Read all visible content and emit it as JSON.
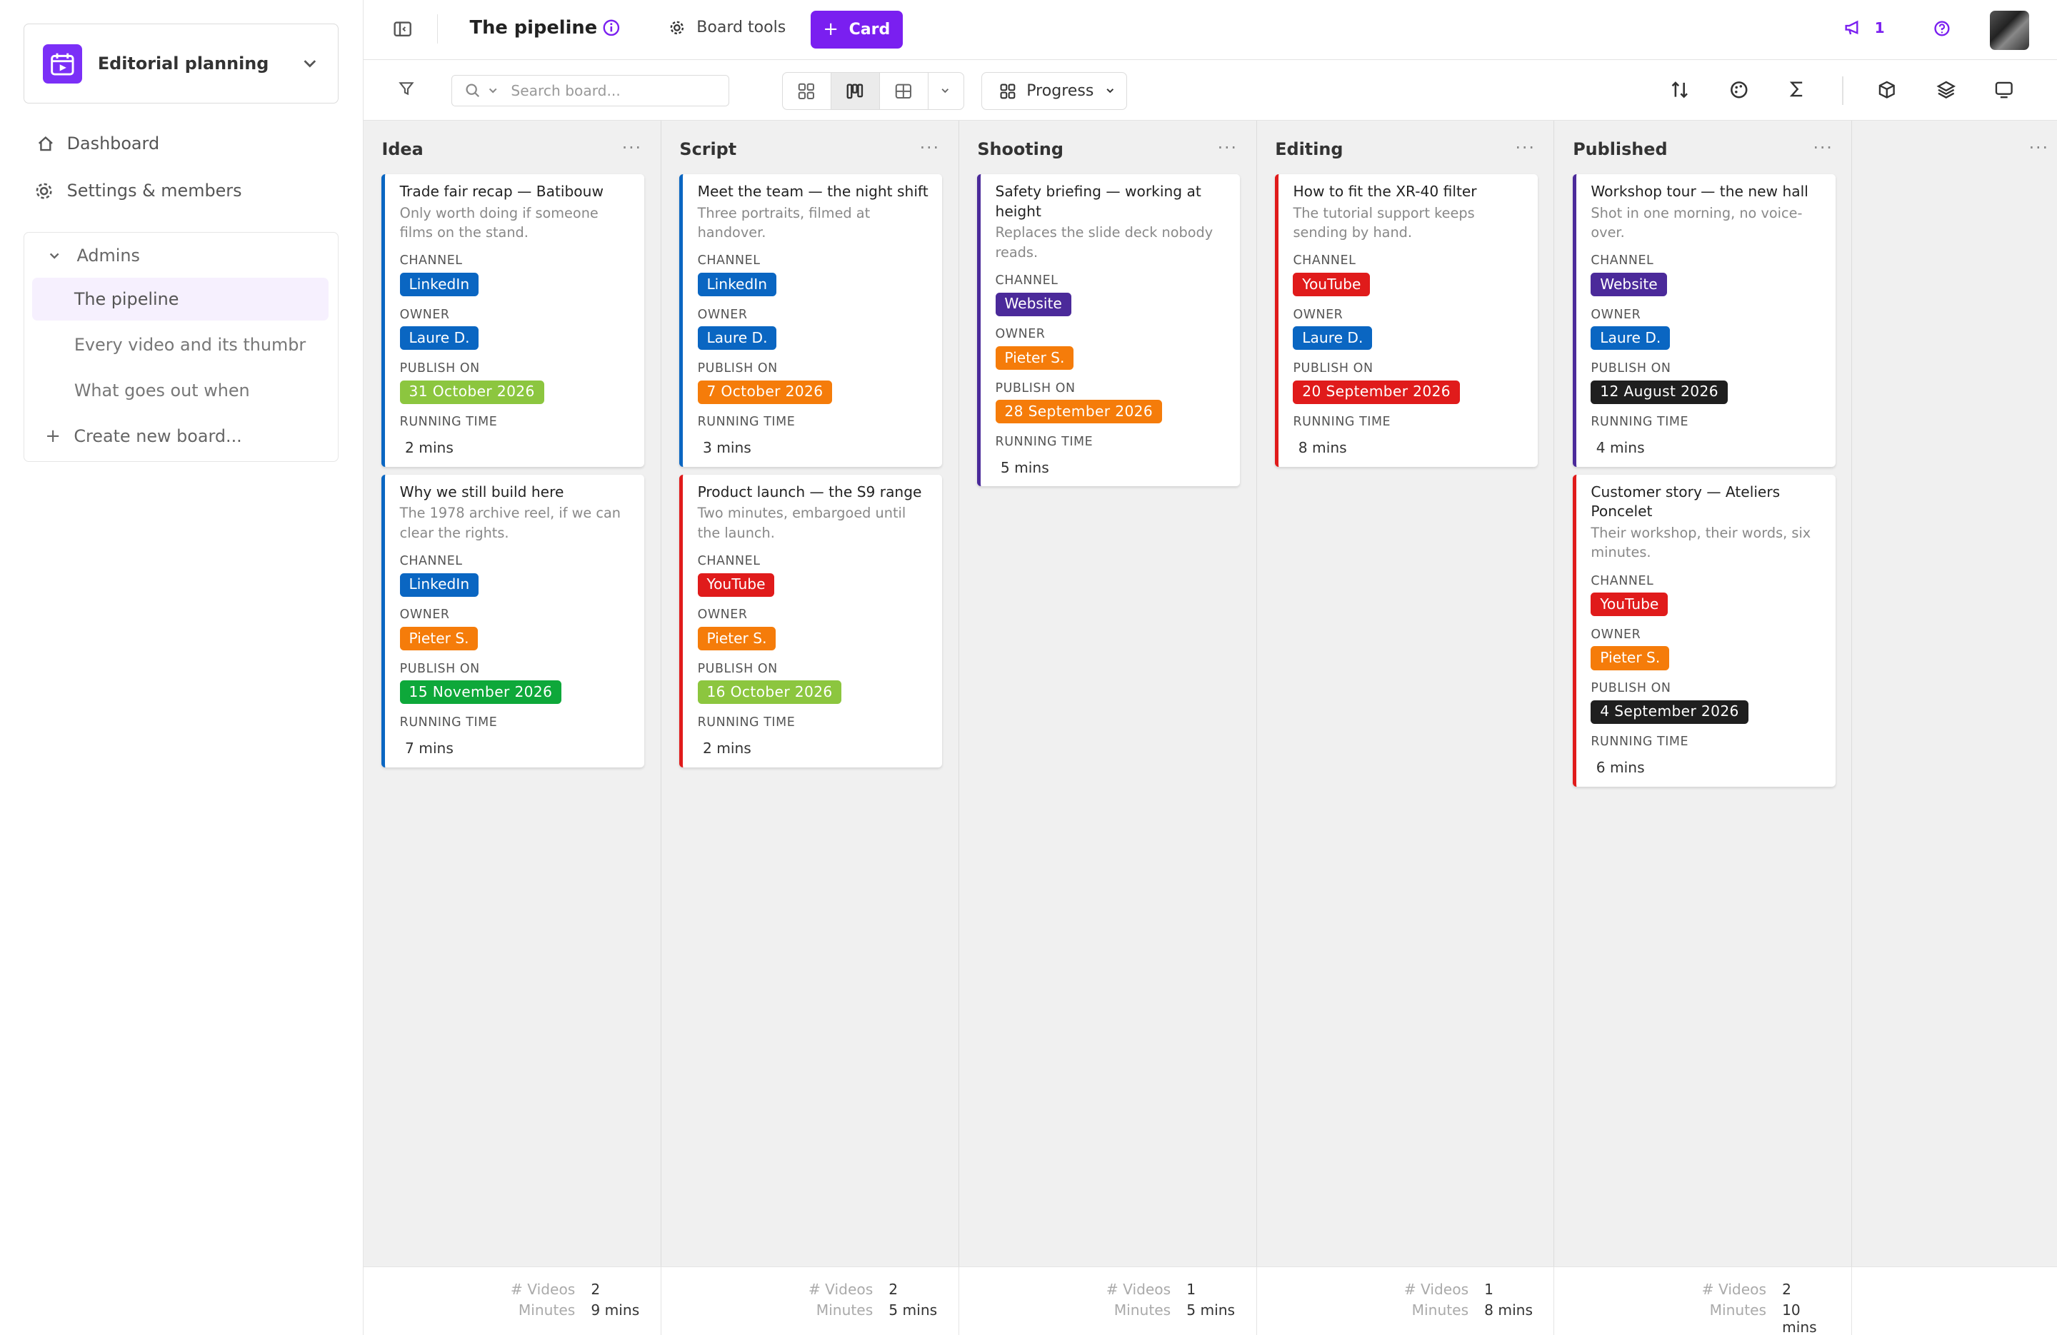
{
  "sidebar": {
    "workspace": "Editorial planning",
    "nav": [
      {
        "label": "Dashboard",
        "icon": "home-icon"
      },
      {
        "label": "Settings & members",
        "icon": "gear-icon"
      }
    ],
    "section_title": "Admins",
    "boards": [
      {
        "label": "The pipeline",
        "active": true
      },
      {
        "label": "Every video and its thumbr",
        "active": false
      },
      {
        "label": "What goes out when",
        "active": false
      }
    ],
    "create_label": "Create new board..."
  },
  "topbar": {
    "title": "The pipeline",
    "board_tools": "Board tools",
    "card_button": "Card",
    "notification_count": "1"
  },
  "toolbar": {
    "search_placeholder": "Search board...",
    "group_by": "Progress"
  },
  "labels": {
    "channel": "CHANNEL",
    "owner": "OWNER",
    "publish_on": "PUBLISH ON",
    "running_time": "RUNNING TIME",
    "footer_count": "# Videos",
    "footer_minutes": "Minutes"
  },
  "colors": {
    "accent": "#7a1ff0",
    "linkedin": "#0a66c2",
    "youtube": "#e01b1b",
    "website": "#4b2a9a",
    "laure": "#0a66c2",
    "pieter": "#f57c0a"
  },
  "columns": [
    {
      "title": "Idea",
      "count": "2",
      "minutes": "9 mins",
      "cards": [
        {
          "title": "Trade fair recap — Batibouw",
          "desc": "Only worth doing if someone films on the stand.",
          "channel": "LinkedIn",
          "owner": "Laure D.",
          "publish": "31 October 2026",
          "publish_color": "#8cc63f",
          "running": "2 mins"
        },
        {
          "title": "Why we still build here",
          "desc": "The 1978 archive reel, if we can clear the rights.",
          "channel": "LinkedIn",
          "owner": "Pieter S.",
          "publish": "15 November 2026",
          "publish_color": "#0ea83a",
          "running": "7 mins"
        }
      ]
    },
    {
      "title": "Script",
      "count": "2",
      "minutes": "5 mins",
      "cards": [
        {
          "title": "Meet the team — the night shift",
          "desc": "Three portraits, filmed at handover.",
          "channel": "LinkedIn",
          "owner": "Laure D.",
          "publish": "7 October 2026",
          "publish_color": "#f57c0a",
          "running": "3 mins"
        },
        {
          "title": "Product launch — the S9 range",
          "desc": "Two minutes, embargoed until the launch.",
          "channel": "YouTube",
          "owner": "Pieter S.",
          "publish": "16 October 2026",
          "publish_color": "#8cc63f",
          "running": "2 mins"
        }
      ]
    },
    {
      "title": "Shooting",
      "count": "1",
      "minutes": "5 mins",
      "cards": [
        {
          "title": "Safety briefing — working at height",
          "desc": "Replaces the slide deck nobody reads.",
          "channel": "Website",
          "owner": "Pieter S.",
          "publish": "28 September 2026",
          "publish_color": "#f57c0a",
          "running": "5 mins"
        }
      ]
    },
    {
      "title": "Editing",
      "count": "1",
      "minutes": "8 mins",
      "cards": [
        {
          "title": "How to fit the XR-40 filter",
          "desc": "The tutorial support keeps sending by hand.",
          "channel": "YouTube",
          "owner": "Laure D.",
          "publish": "20 September 2026",
          "publish_color": "#e01b1b",
          "running": "8 mins"
        }
      ]
    },
    {
      "title": "Published",
      "count": "2",
      "minutes": "10 mins",
      "cards": [
        {
          "title": "Workshop tour — the new hall",
          "desc": "Shot in one morning, no voice-over.",
          "channel": "Website",
          "owner": "Laure D.",
          "publish": "12 August 2026",
          "publish_color": "#1f1f1f",
          "running": "4 mins"
        },
        {
          "title": "Customer story — Ateliers Poncelet",
          "desc": "Their workshop, their words, six minutes.",
          "channel": "YouTube",
          "owner": "Pieter S.",
          "publish": "4 September 2026",
          "publish_color": "#1f1f1f",
          "running": "6 mins"
        }
      ]
    }
  ]
}
